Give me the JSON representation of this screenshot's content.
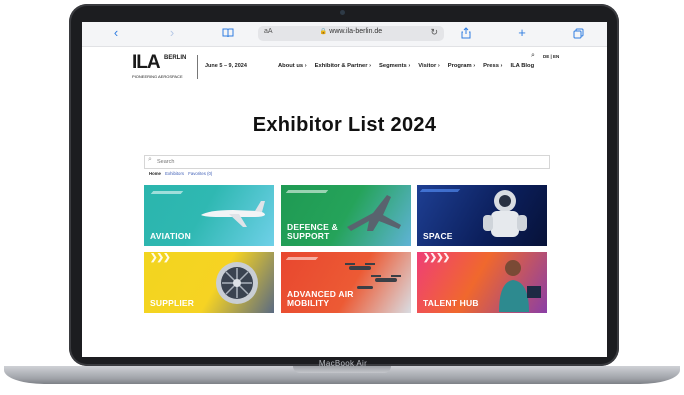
{
  "device": {
    "model_label": "MacBook Air"
  },
  "browser": {
    "text_size": "aA",
    "url": "www.ila-berlin.de",
    "back_icon": "chevron-left-icon",
    "forward_icon": "chevron-right-icon",
    "bookmarks_icon": "book-icon",
    "share_icon": "share-icon",
    "new_tab_icon": "plus-icon",
    "tabs_icon": "tabs-icon",
    "accent": "#2f7de1"
  },
  "site": {
    "logo_main": "ILA",
    "logo_city": "BERLIN",
    "logo_tagline": "PIONEERING AEROSPACE",
    "dates": "June 5 – 9, 2024",
    "lang": "DE | EN",
    "nav": [
      "About us ›",
      "Exhibitor & Partner ›",
      "Segments ›",
      "Visitor ›",
      "Program ›",
      "Press ›",
      "ILA Blog"
    ]
  },
  "main": {
    "title": "Exhibitor List 2024",
    "search_placeholder": "Search",
    "breadcrumbs": [
      "Home",
      "Exhibitors",
      "Favorites (0)"
    ],
    "tiles": [
      {
        "label": "AVIATION",
        "color": "#2bb5ad"
      },
      {
        "label": "DEFENCE &\nSUPPORT",
        "color": "#1f9a53"
      },
      {
        "label": "SPACE",
        "color": "#1e3f93"
      },
      {
        "label": "SUPPLIER",
        "color": "#f2d51f"
      },
      {
        "label": "ADVANCED AIR\nMOBILITY",
        "color": "#e8472f"
      },
      {
        "label": "TALENT HUB",
        "color": "#ef3e77"
      }
    ]
  }
}
